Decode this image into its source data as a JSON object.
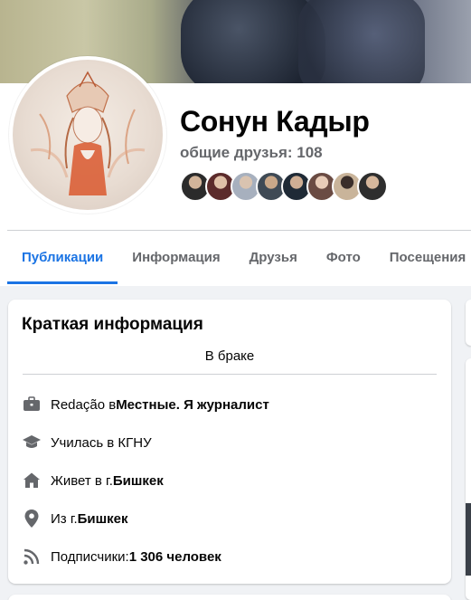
{
  "profile": {
    "name": "Сонун Кадыр",
    "mutual_friends": "общие друзья: 108",
    "friend_avatars": [
      {
        "color": "#2b2b2b"
      },
      {
        "color": "#5c2b2b"
      },
      {
        "color": "#a7b0be"
      },
      {
        "color": "#3f4a55"
      },
      {
        "color": "#1f2a36"
      },
      {
        "color": "#6a4b43"
      },
      {
        "color": "#c9b49a"
      },
      {
        "color": "#2e2e2e"
      }
    ]
  },
  "tabs": [
    {
      "label": "Публикации",
      "active": true
    },
    {
      "label": "Информация",
      "active": false
    },
    {
      "label": "Друзья",
      "active": false
    },
    {
      "label": "Фото",
      "active": false
    },
    {
      "label": "Посещения",
      "active": false
    }
  ],
  "intro": {
    "title": "Краткая информация",
    "status": "В браке",
    "rows": [
      {
        "icon": "briefcase-icon",
        "prefix": "Redação в ",
        "bold": "Местные. Я журналист"
      },
      {
        "icon": "graduation-cap-icon",
        "prefix": "Училась в КГНУ",
        "bold": ""
      },
      {
        "icon": "home-icon",
        "prefix": "Живет в г. ",
        "bold": "Бишкек"
      },
      {
        "icon": "location-pin-icon",
        "prefix": "Из г. ",
        "bold": "Бишкек"
      },
      {
        "icon": "rss-icon",
        "prefix": "Подписчики: ",
        "bold": "1 306 человек"
      }
    ]
  },
  "colors": {
    "accent": "#1b74e4",
    "secondary_text": "#65676b",
    "icon_gray": "#65676b"
  }
}
